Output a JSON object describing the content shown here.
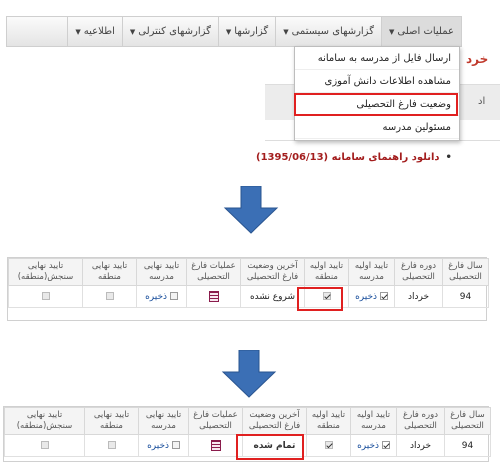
{
  "menubar": {
    "items": [
      {
        "label": "عملیات اصلی"
      },
      {
        "label": "گزارشهای سیستمی"
      },
      {
        "label": "گزارشها"
      },
      {
        "label": "گزارشهای کنترلی"
      },
      {
        "label": "اطلاعیه"
      }
    ],
    "dropdown": [
      {
        "label": "ارسال فایل از مدرسه به سامانه"
      },
      {
        "label": "مشاهده اطلاعات دانش آموزی"
      },
      {
        "label": "وضعیت فارغ التحصیلی"
      },
      {
        "label": "مسئولین مدرسه"
      }
    ],
    "behind_title": "خرد",
    "behind_text": "اد"
  },
  "download_link": "دانلود راهنمای سامانه (1395/06/13)",
  "table1": {
    "headers": [
      "سال فارغ التحصیلی",
      "دوره فارغ التحصیلی",
      "تایید اولیه مدرسه",
      "تایید اولیه منطقه",
      "آخرین وضعیت فارغ التحصیلی",
      "عملیات فارغ التحصیلی",
      "تایید نهایی مدرسه",
      "تایید نهایی منطقه",
      "تایید نهایی سنجش(منطقه)"
    ],
    "row": {
      "year": "94",
      "period": "خرداد",
      "save": "ذخیره",
      "status": "شروع نشده"
    }
  },
  "table2": {
    "headers": [
      "سال فارغ التحصیلی",
      "دوره فارغ التحصیلی",
      "تایید اولیه مدرسه",
      "تایید اولیه منطقه",
      "آخرین وضعیت فارغ التحصیلی",
      "عملیات فارغ التحصیلی",
      "تایید نهایی مدرسه",
      "تایید نهایی منطقه",
      "تایید نهایی سنجش(منطقه)"
    ],
    "row": {
      "year": "94",
      "period": "خرداد",
      "save": "ذخیره",
      "status": "تمام شده"
    }
  },
  "colors": {
    "arrow": "#3b6fb5",
    "highlight": "#e02020",
    "link": "#1a4f9c",
    "download": "#a31d1d"
  },
  "icons": {
    "arrow": "arrow-down-icon",
    "calc": "calculator-icon"
  }
}
